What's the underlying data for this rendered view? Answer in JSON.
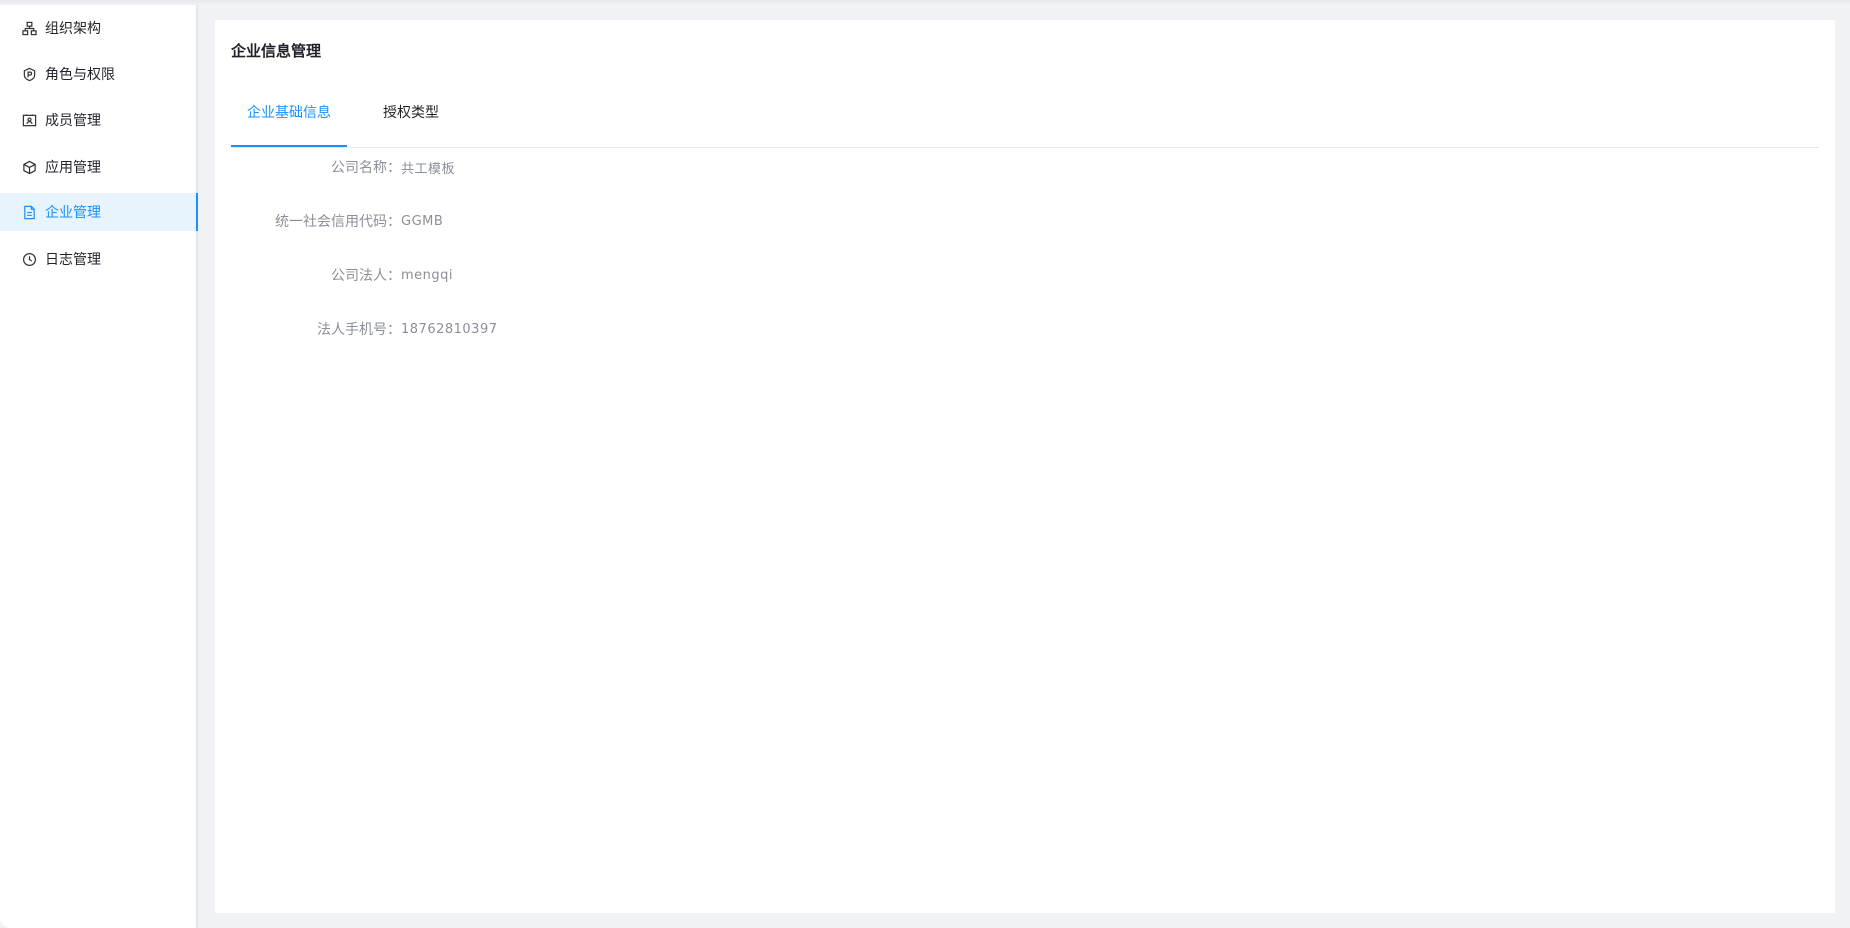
{
  "sidebar": {
    "items": [
      {
        "label": "组织架构",
        "icon": "org-structure-icon"
      },
      {
        "label": "角色与权限",
        "icon": "shield-icon"
      },
      {
        "label": "成员管理",
        "icon": "id-card-icon"
      },
      {
        "label": "应用管理",
        "icon": "cube-icon"
      },
      {
        "label": "企业管理",
        "icon": "document-icon",
        "active": true
      },
      {
        "label": "日志管理",
        "icon": "clock-icon"
      }
    ]
  },
  "main": {
    "title": "企业信息管理",
    "tabs": [
      {
        "label": "企业基础信息",
        "active": true
      },
      {
        "label": "授权类型",
        "active": false
      }
    ],
    "fields": [
      {
        "label": "公司名称：",
        "value": "共工模板"
      },
      {
        "label": "统一社会信用代码：",
        "value": "GGMB"
      },
      {
        "label": "公司法人：",
        "value": "mengqi"
      },
      {
        "label": "法人手机号：",
        "value": "18762810397"
      }
    ]
  },
  "colors": {
    "accent": "#1890ff",
    "active_bg": "#e8f4fd",
    "label_gray": "#8a8f99",
    "page_bg": "#f0f2f5"
  }
}
